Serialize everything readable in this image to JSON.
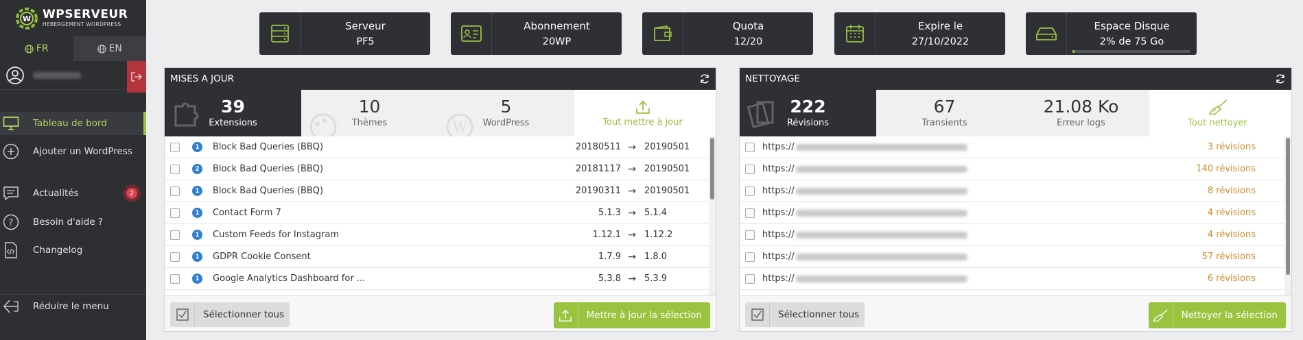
{
  "brand": {
    "name": "WPSERVEUR",
    "tagline": "HEBERGEMENT WORDPRESS"
  },
  "languages": [
    {
      "code": "FR",
      "active": true
    },
    {
      "code": "EN",
      "active": false
    }
  ],
  "nav": {
    "dashboard": "Tableau de bord",
    "add_wordpress": "Ajouter un WordPress",
    "news": "Actualités",
    "news_badge": "2",
    "help": "Besoin d'aide ?",
    "changelog": "Changelog",
    "collapse": "Réduire le menu"
  },
  "stats": [
    {
      "label": "Serveur",
      "value": "PF5",
      "icon": "server-icon"
    },
    {
      "label": "Abonnement",
      "value": "20WP",
      "icon": "id-card-icon"
    },
    {
      "label": "Quota",
      "value": "12/20",
      "icon": "wallet-icon"
    },
    {
      "label": "Expire le",
      "value": "27/10/2022",
      "icon": "calendar-icon"
    },
    {
      "label": "Espace Disque",
      "value": "2% de 75 Go",
      "icon": "hard-drive-icon",
      "usage_percent": 2
    }
  ],
  "updates": {
    "title": "MISES A JOUR",
    "tabs": [
      {
        "num": "39",
        "label": "Extensions"
      },
      {
        "num": "10",
        "label": "Thèmes"
      },
      {
        "num": "5",
        "label": "WordPress"
      }
    ],
    "update_all": "Tout mettre à jour",
    "rows": [
      {
        "badge": "1",
        "name": "Block Bad Queries (BBQ)",
        "from": "20180511",
        "to": "20190501"
      },
      {
        "badge": "2",
        "name": "Block Bad Queries (BBQ)",
        "from": "20181117",
        "to": "20190501"
      },
      {
        "badge": "1",
        "name": "Block Bad Queries (BBQ)",
        "from": "20190311",
        "to": "20190501"
      },
      {
        "badge": "1",
        "name": "Contact Form 7",
        "from": "5.1.3",
        "to": "5.1.4"
      },
      {
        "badge": "1",
        "name": "Custom Feeds for Instagram",
        "from": "1.12.1",
        "to": "1.12.2"
      },
      {
        "badge": "1",
        "name": "GDPR Cookie Consent",
        "from": "1.7.9",
        "to": "1.8.0"
      },
      {
        "badge": "1",
        "name": "Google Analytics Dashboard for ...",
        "from": "5.3.8",
        "to": "5.3.9"
      }
    ],
    "select_all": "Sélectionner tous",
    "update_selection": "Mettre à jour la sélection"
  },
  "cleanup": {
    "title": "NETTOYAGE",
    "tabs": [
      {
        "num": "222",
        "label": "Révisions"
      },
      {
        "num": "67",
        "label": "Transients"
      },
      {
        "num": "21.08 Ko",
        "label": "Erreur logs"
      }
    ],
    "clean_all": "Tout nettoyer",
    "rows": [
      {
        "url": "https://",
        "revisions": "3 révisions"
      },
      {
        "url": "https://",
        "revisions": "140 révisions"
      },
      {
        "url": "https://",
        "revisions": "8 révisions"
      },
      {
        "url": "https://",
        "revisions": "4 révisions"
      },
      {
        "url": "https://",
        "revisions": "4 révisions"
      },
      {
        "url": "https://",
        "revisions": "57 révisions"
      },
      {
        "url": "https://",
        "revisions": "6 révisions"
      }
    ],
    "select_all": "Sélectionner tous",
    "clean_selection": "Nettoyer la sélection"
  },
  "colors": {
    "accent": "#9ac33f",
    "dark": "#2e3035",
    "badge_blue": "#2f7fd1",
    "revision_orange": "#d48a27",
    "alert_red": "#d9434d"
  }
}
